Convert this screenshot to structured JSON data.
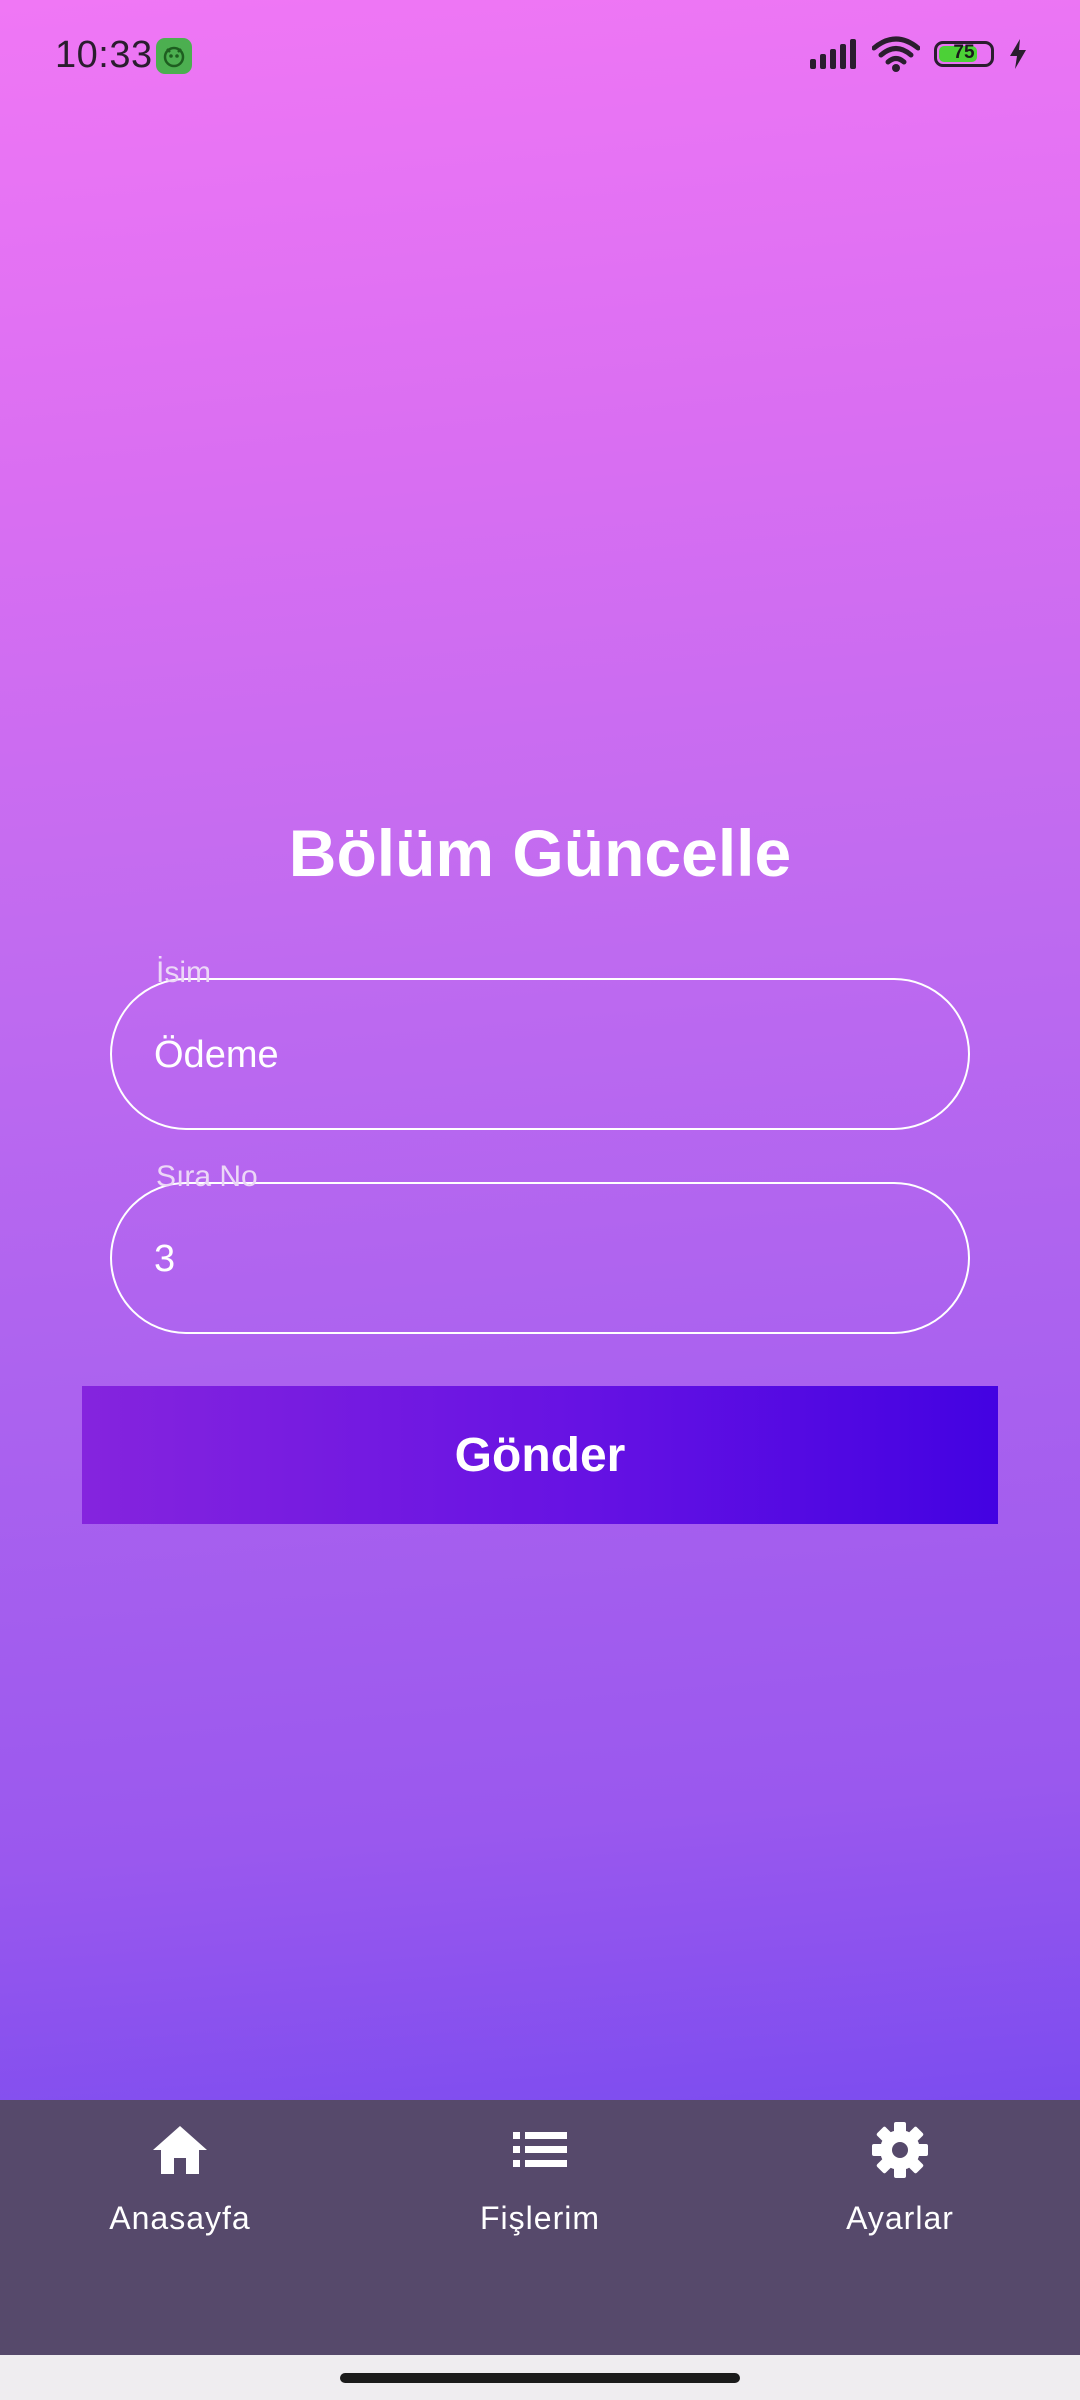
{
  "status_bar": {
    "time": "10:33",
    "battery_level": "75",
    "battery_fraction": 0.75,
    "icons": [
      "app-notification-icon",
      "signal-icon",
      "wifi-icon",
      "battery-icon",
      "charging-bolt-icon"
    ]
  },
  "page": {
    "title": "Bölüm Güncelle"
  },
  "form": {
    "name_label": "İsim",
    "name_value": "Ödeme",
    "order_label": "Sıra No",
    "order_value": "3",
    "submit_label": "Gönder"
  },
  "bottom_nav": {
    "items": [
      {
        "label": "Anasayfa",
        "icon": "home-icon"
      },
      {
        "label": "Fişlerim",
        "icon": "list-icon"
      },
      {
        "label": "Ayarlar",
        "icon": "gear-icon"
      }
    ]
  },
  "colors": {
    "gradient_top": "#f077f5",
    "gradient_bottom": "#7c4cef",
    "button_start": "#8524de",
    "button_end": "#4302e2",
    "nav_background": "#56496b"
  }
}
